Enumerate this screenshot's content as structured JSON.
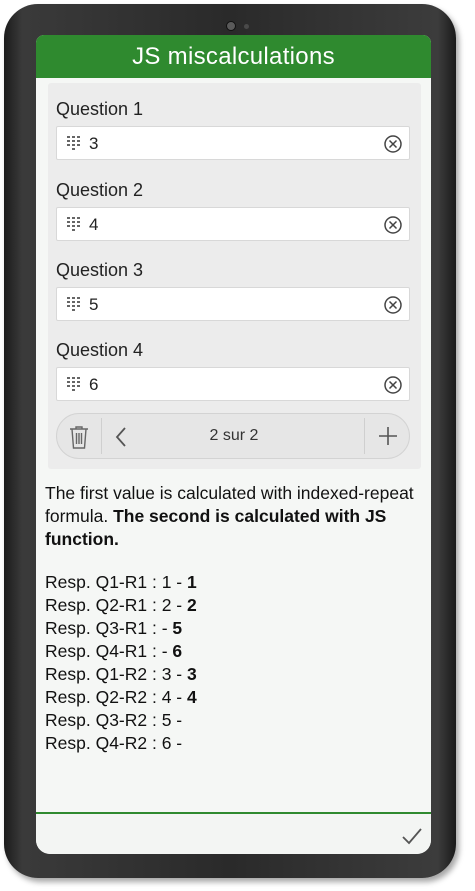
{
  "header": {
    "title": "JS miscalculations"
  },
  "questions": [
    {
      "label": "Question 1",
      "value": "3"
    },
    {
      "label": "Question 2",
      "value": "4"
    },
    {
      "label": "Question 3",
      "value": "5"
    },
    {
      "label": "Question 4",
      "value": "6"
    }
  ],
  "nav": {
    "pager": "2 sur 2"
  },
  "note": {
    "normal": "The first value is calculated with indexed-repeat formula. ",
    "bold": "The second is calculated with JS function."
  },
  "responses": [
    {
      "prefix": "Resp. Q1-R1 : 1 - ",
      "bold": "1"
    },
    {
      "prefix": "Resp. Q2-R1 : 2 - ",
      "bold": "2"
    },
    {
      "prefix": "Resp. Q3-R1 : - ",
      "bold": "5"
    },
    {
      "prefix": "Resp. Q4-R1 : - ",
      "bold": "6"
    },
    {
      "prefix": "Resp. Q1-R2 : 3 - ",
      "bold": "3"
    },
    {
      "prefix": "Resp. Q2-R2 : 4 - ",
      "bold": "4"
    },
    {
      "prefix": "Resp. Q3-R2 : 5 - ",
      "bold": ""
    },
    {
      "prefix": "Resp. Q4-R2 : 6 - ",
      "bold": ""
    }
  ],
  "colors": {
    "accent": "#2f8a2f",
    "background": "#f5f7f5",
    "group": "#ececec"
  },
  "icons": [
    "keypad-icon",
    "clear-icon",
    "trash-icon",
    "chevron-left-icon",
    "plus-icon",
    "check-icon"
  ]
}
